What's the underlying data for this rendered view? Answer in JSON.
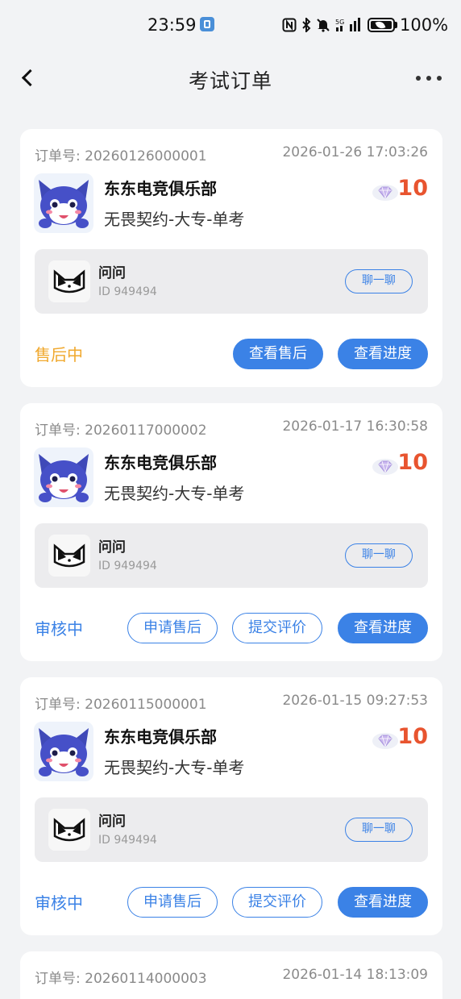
{
  "status_bar": {
    "time": "23:59",
    "icons": [
      "nfc-icon",
      "bluetooth-icon",
      "mute-icon",
      "signal-5g-icon"
    ],
    "battery": "100%",
    "battery_level": 1.0
  },
  "header": {
    "title": "考试订单"
  },
  "orders": [
    {
      "order_no": "订单号: 20260126000001",
      "time": "2026-01-26 17:03:26",
      "club": "东东电竞俱乐部",
      "product": "无畏契约-大专-单考",
      "price": "10",
      "user_name": "问问",
      "user_id": "ID 949494",
      "chat_label": "聊一聊",
      "status": "售后中",
      "btn_a": "查看售后",
      "btn_b": "查看进度"
    },
    {
      "order_no": "订单号: 20260117000002",
      "time": "2026-01-17 16:30:58",
      "club": "东东电竞俱乐部",
      "product": "无畏契约-大专-单考",
      "price": "10",
      "user_name": "问问",
      "user_id": "ID 949494",
      "chat_label": "聊一聊",
      "status": "审核中",
      "btn_a": "申请售后",
      "btn_b": "提交评价",
      "btn_c": "查看进度"
    },
    {
      "order_no": "订单号: 20260115000001",
      "time": "2026-01-15 09:27:53",
      "club": "东东电竞俱乐部",
      "product": "无畏契约-大专-单考",
      "price": "10",
      "user_name": "问问",
      "user_id": "ID 949494",
      "chat_label": "聊一聊",
      "status": "审核中",
      "btn_a": "申请售后",
      "btn_b": "提交评价",
      "btn_c": "查看进度"
    },
    {
      "order_no": "订单号: 20260114000003",
      "time": "2026-01-14 18:13:09"
    }
  ],
  "colors": {
    "primary": "#3b82e6",
    "price": "#e8542f",
    "status_after_sale": "#f0a82d",
    "status_review": "#3b82e6"
  }
}
